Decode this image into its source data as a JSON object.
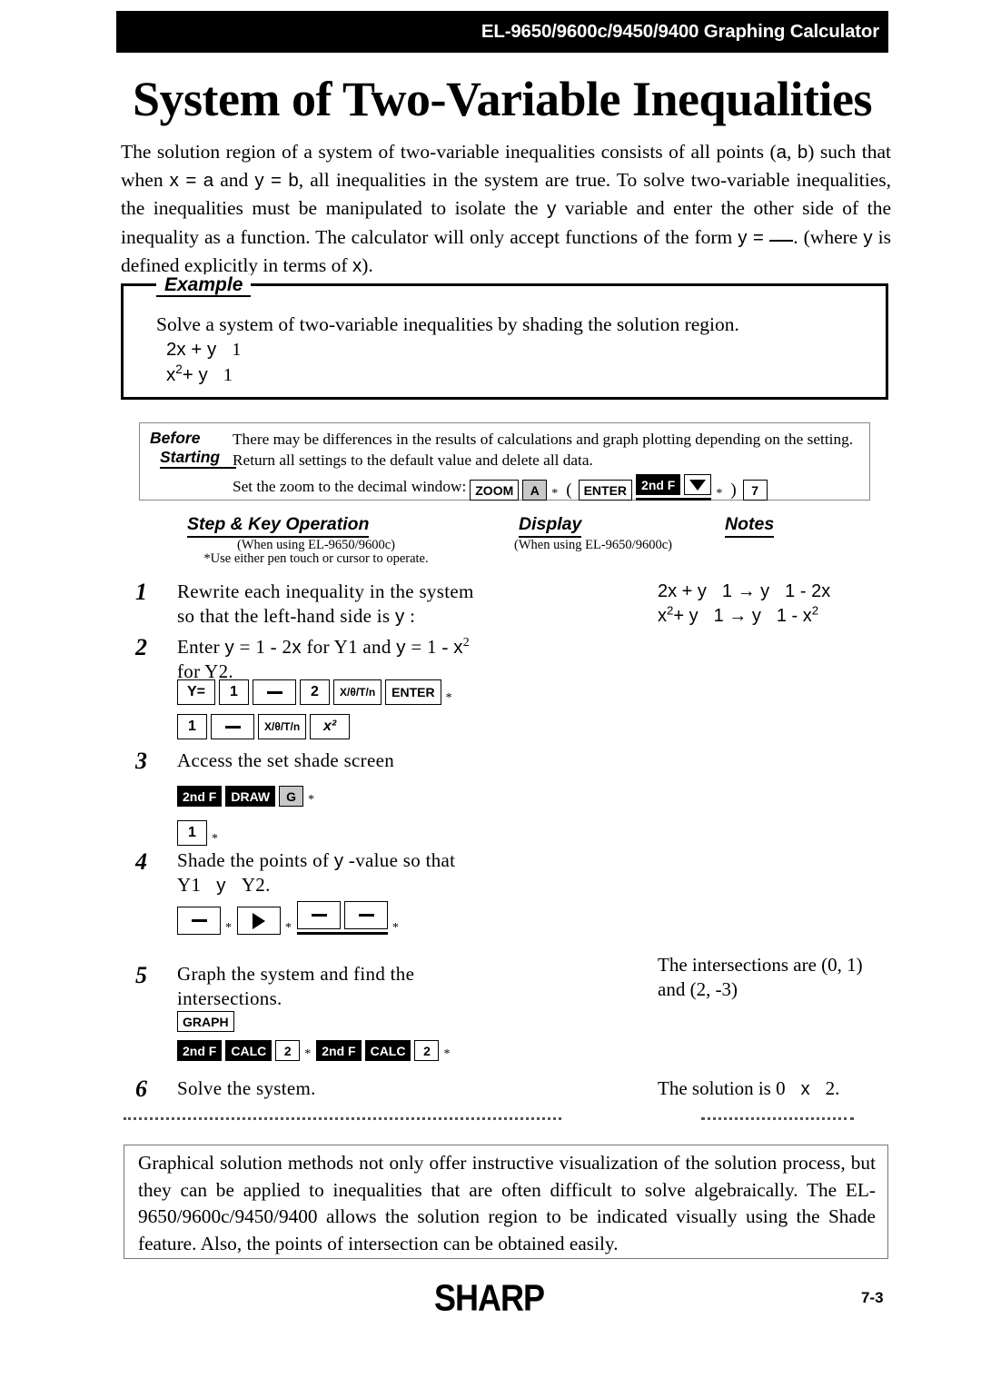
{
  "header": {
    "title": "EL-9650/9600c/9450/9400 Graphing Calculator"
  },
  "page_title": "System of Two-Variable Inequalities",
  "intro": {
    "line1_a": "The solution region of a system of two-variable inequalities consists of all points (",
    "var_a": "a",
    "comma": ", ",
    "var_b": "b",
    "line1_b": ") such that when ",
    "x_eq": "x = ",
    "a2": "a",
    "and1": " and ",
    "y_eq": "y = ",
    "b2": "b",
    "line2_b": ", all inequalities in the system are true. To solve two-variable inequalities, the inequalities must be manipulated to isolate the ",
    "y3": "y",
    "line3_b": " variable and enter the other side of the inequality as a function. The calculator will only accept functions of the form ",
    "y4": "y = ",
    "line4_b": ". (where ",
    "y5": "y",
    "line4_c": " is defined explicitly in terms of ",
    "x5": "x",
    "line4_d": ")."
  },
  "example": {
    "tab_label": "Example",
    "statement": "Solve a system of two-variable inequalities by shading the solution region.",
    "eq1_lhs": "2x + y",
    "eq1_op": "",
    "eq1_rhs": "1",
    "eq2_lhs": "x",
    "eq2_exp": "2",
    "eq2_lhs2": "+ y",
    "eq2_op": "",
    "eq2_rhs": "1"
  },
  "before_starting": {
    "label_line1": "Before",
    "label_line2": "Starting",
    "note1": "There may be differences in the results of calculations and graph plotting depending on the setting.",
    "note2": "Return all settings to the default value and delete all data.",
    "note3": "Set the zoom to the decimal window:",
    "keys": {
      "zoom": "ZOOM",
      "a": "A",
      "star": "*",
      "open_paren": "(",
      "enter": "ENTER",
      "second_f": "2nd F",
      "down_arrow": "down-arrow",
      "close_paren": ")",
      "seven": "7"
    }
  },
  "columns": {
    "step_key": "Step & Key Operation",
    "step_key_sub": "(When using EL-9650/9600c)",
    "step_key_sub2": "*Use either pen touch or cursor to operate.",
    "display": "Display",
    "display_sub": "(When using EL-9650/9600c)",
    "notes": "Notes"
  },
  "steps": [
    {
      "num": "1",
      "text_line1": "Rewrite each inequality in the system",
      "text_line2a": "so that the left-hand side is ",
      "text_line2b": "y",
      "text_line2c": " :",
      "display_line1a": "2x + y",
      "display_line1b": "1",
      "display_arrow": "→",
      "display_line1c": "y",
      "display_line1d": "1 - 2x",
      "display_line2a": "x",
      "display_line2exp": "2",
      "display_line2b": "+ y",
      "display_line2c": "1",
      "display_line2d": "y",
      "display_line2e": "1 - x",
      "display_line2exp2": "2"
    },
    {
      "num": "2",
      "text_line1a": "Enter ",
      "text_line1b": "y",
      "text_line1c": " = 1 - 2",
      "text_line1d": "x",
      "text_line1e": " for Y1 and ",
      "text_line1f": "y",
      "text_line1g": " = 1 - ",
      "text_line1h": "x",
      "text_line1exp": "2",
      "text_line2": "for Y2.",
      "keys_row1": [
        "Y=",
        "1",
        "minus",
        "2",
        "X/θ/T/n",
        "ENTER"
      ],
      "keys_row2": [
        "1",
        "minus",
        "X/θ/T/n",
        "x²"
      ]
    },
    {
      "num": "3",
      "text_line1": "Access the set shade screen",
      "keys_row1": [
        "2nd F",
        "DRAW",
        "G"
      ],
      "keys_row2": [
        "1"
      ]
    },
    {
      "num": "4",
      "text_line1a": "Shade the points of ",
      "text_line1b": "y",
      "text_line1c": " -value so that",
      "text_line2a": "Y1",
      "text_line2b": "y",
      "text_line2c": "Y2.",
      "keys_row1": [
        "minus",
        "right-arrow",
        "minus",
        "minus"
      ]
    },
    {
      "num": "5",
      "text_line1": "Graph the system and find the",
      "text_line2": "intersections.",
      "keys_row1": [
        "GRAPH"
      ],
      "keys_row2": [
        "2nd F",
        "CALC",
        "2",
        "2nd F",
        "CALC",
        "2"
      ],
      "display_line1": "The intersections are (0, 1)",
      "display_line2": "and (2, -3)"
    },
    {
      "num": "6",
      "text_line1": "Solve the system.",
      "display_line1a": "The solution is 0",
      "display_line1b": "x",
      "display_line1c": "2."
    }
  ],
  "conclusion": {
    "text": "Graphical solution methods not only offer instructive visualization of the solution process, but they can be applied to inequalities that are often difficult to solve algebraically. The EL-9650/9600c/9450/9400 allows the solution region to be indicated visually using the Shade feature. Also, the points of intersection can be obtained easily."
  },
  "footer": {
    "brand": "SHARP",
    "page_number": "7-3"
  }
}
